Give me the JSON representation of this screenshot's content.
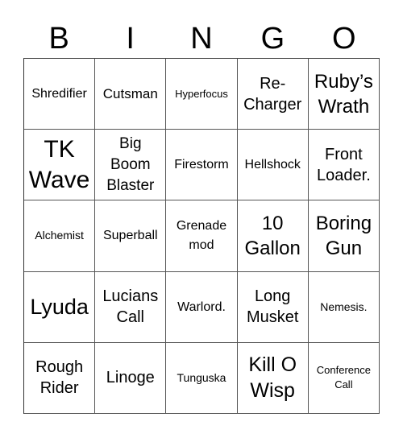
{
  "header": [
    "B",
    "I",
    "N",
    "G",
    "O"
  ],
  "rows": [
    [
      "Shredifier",
      "Cutsman",
      "Hyperfocus",
      "Re-\nCharger",
      "Ruby’s\nWrath"
    ],
    [
      "TK\nWave",
      "Big\nBoom\nBlaster",
      "Firestorm",
      "Hellshock",
      "Front\nLoader."
    ],
    [
      "Alchemist",
      "Superball",
      "Grenade\nmod",
      "10\nGallon",
      "Boring\nGun"
    ],
    [
      "Lyuda",
      "Lucians\nCall",
      "Warlord.",
      "Long\nMusket",
      "Nemesis."
    ],
    [
      "Rough\nRider",
      "Linoge",
      "Tunguska",
      "Kill O\nWisp",
      "Conference\nCall"
    ]
  ],
  "cells": {
    "r0c0": "Shredifier",
    "r0c1": "Cutsman",
    "r0c2": "Hyperfocus",
    "r0c3a": "Re-",
    "r0c3b": "Charger",
    "r0c4a": "Ruby’s",
    "r0c4b": "Wrath",
    "r1c0a": "TK",
    "r1c0b": "Wave",
    "r1c1a": "Big",
    "r1c1b": "Boom",
    "r1c1c": "Blaster",
    "r1c2": "Firestorm",
    "r1c3": "Hellshock",
    "r1c4a": "Front",
    "r1c4b": "Loader.",
    "r2c0": "Alchemist",
    "r2c1": "Superball",
    "r2c2a": "Grenade",
    "r2c2b": "mod",
    "r2c3a": "10",
    "r2c3b": "Gallon",
    "r2c4a": "Boring",
    "r2c4b": "Gun",
    "r3c0": "Lyuda",
    "r3c1a": "Lucians",
    "r3c1b": "Call",
    "r3c2": "Warlord.",
    "r3c3a": "Long",
    "r3c3b": "Musket",
    "r3c4": "Nemesis.",
    "r4c0a": "Rough",
    "r4c0b": "Rider",
    "r4c1": "Linoge",
    "r4c2": "Tunguska",
    "r4c3a": "Kill O",
    "r4c3b": "Wisp",
    "r4c4a": "Conference",
    "r4c4b": "Call"
  }
}
